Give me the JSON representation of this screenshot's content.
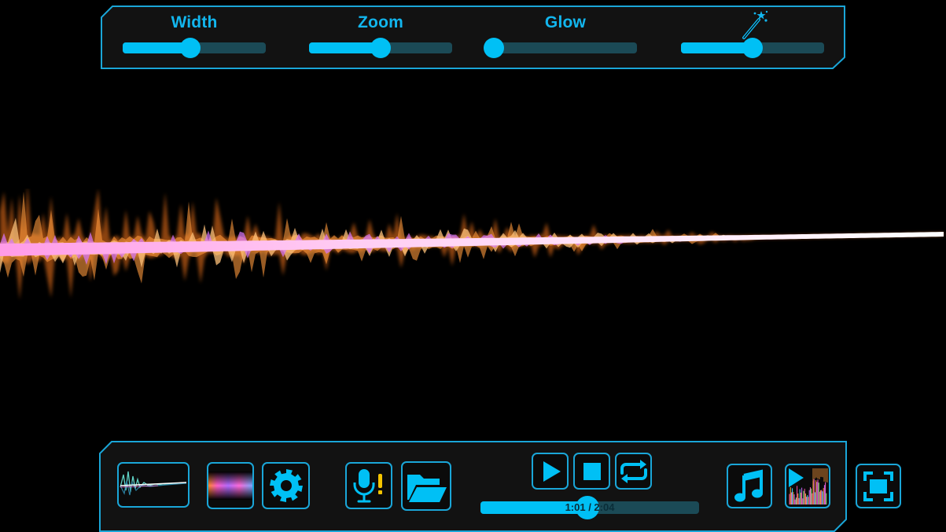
{
  "colors": {
    "accent": "#00c0f5",
    "border": "#1aa6d8",
    "track": "#1b4a56",
    "panel_bg": "#121212",
    "warning": "#f5c400"
  },
  "sliders": [
    {
      "label": "Width",
      "value": 0.47
    },
    {
      "label": "Zoom",
      "value": 0.5
    },
    {
      "label": "Glow",
      "value": 0.0
    },
    {
      "label": "",
      "icon": "magic-wand-icon",
      "value": 0.5
    }
  ],
  "controls": {
    "waveform_style": {
      "icon": "waveform-thumbnail-icon"
    },
    "color_palette": {
      "icon": "color-gradient-icon"
    },
    "settings": {
      "icon": "gear-icon"
    },
    "microphone": {
      "icon": "microphone-warning-icon"
    },
    "open_folder": {
      "icon": "folder-open-icon"
    },
    "play": {
      "icon": "play-icon"
    },
    "stop": {
      "icon": "stop-icon"
    },
    "repeat": {
      "icon": "repeat-icon"
    },
    "music_library": {
      "icon": "music-note-icon"
    },
    "visualizer_mode": {
      "icon": "play-spectrum-icon"
    },
    "fullscreen": {
      "icon": "fullscreen-icon"
    }
  },
  "playback": {
    "time_label": "1:01 / 2:04",
    "progress": 0.49
  }
}
